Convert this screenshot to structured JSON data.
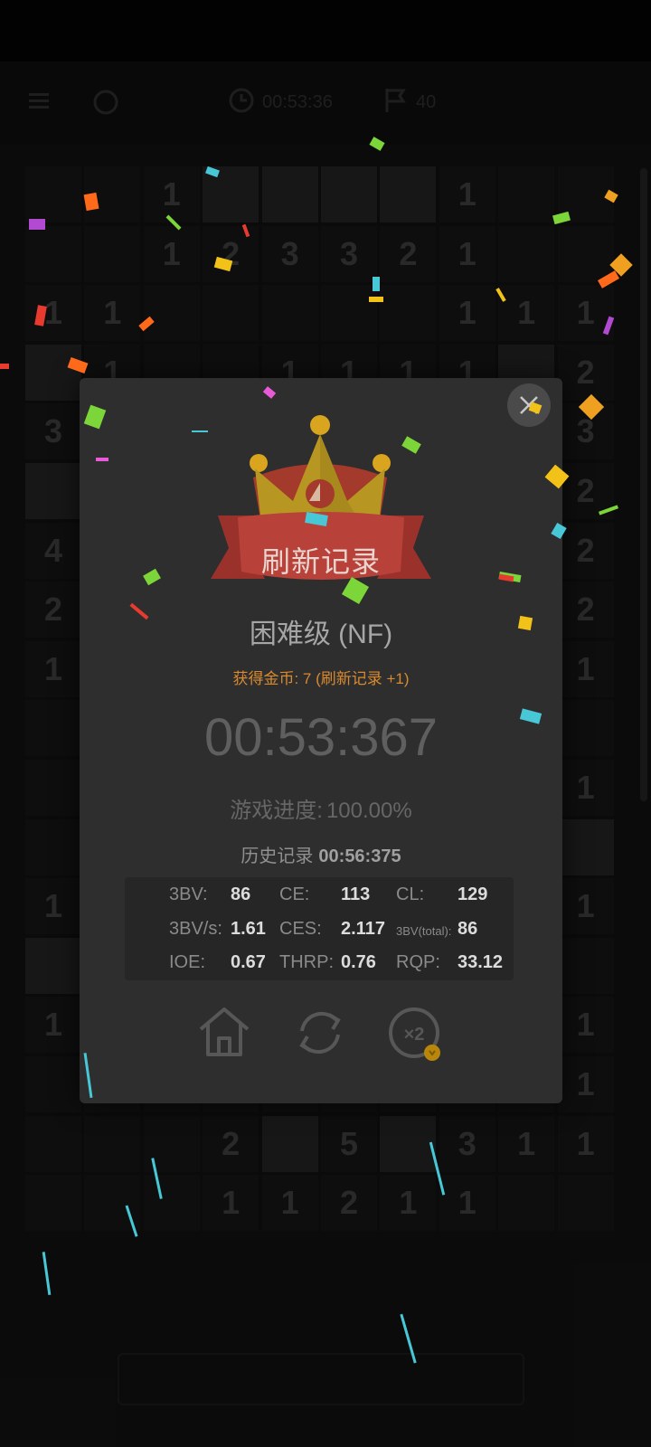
{
  "topbar": {
    "timer": "00:53:36",
    "mines": "40"
  },
  "board": {
    "rows": [
      [
        " ",
        " ",
        "1",
        "#",
        "#",
        "#",
        "#",
        "1",
        " ",
        " "
      ],
      [
        " ",
        " ",
        "1",
        "2",
        "3",
        "3",
        "2",
        "1",
        " ",
        " "
      ],
      [
        "1",
        "1",
        " ",
        " ",
        " ",
        " ",
        " ",
        "1",
        "1",
        "1"
      ],
      [
        "#",
        "1",
        " ",
        " ",
        "1",
        "1",
        "1",
        "1",
        "#",
        "2"
      ],
      [
        "3",
        " ",
        " ",
        " ",
        " ",
        " ",
        " ",
        " ",
        " ",
        "3"
      ],
      [
        "#",
        " ",
        " ",
        " ",
        " ",
        " ",
        " ",
        " ",
        " ",
        "2"
      ],
      [
        "4",
        " ",
        " ",
        " ",
        " ",
        " ",
        " ",
        " ",
        " ",
        "2"
      ],
      [
        "2",
        " ",
        " ",
        " ",
        " ",
        " ",
        " ",
        " ",
        " ",
        "2"
      ],
      [
        "1",
        " ",
        " ",
        " ",
        " ",
        " ",
        " ",
        " ",
        " ",
        "1"
      ],
      [
        " ",
        " ",
        " ",
        " ",
        " ",
        " ",
        " ",
        " ",
        " ",
        " "
      ],
      [
        " ",
        " ",
        " ",
        " ",
        " ",
        " ",
        " ",
        " ",
        " ",
        "1"
      ],
      [
        " ",
        " ",
        " ",
        " ",
        " ",
        " ",
        " ",
        " ",
        " ",
        "#"
      ],
      [
        "1",
        " ",
        " ",
        " ",
        " ",
        " ",
        " ",
        " ",
        " ",
        "1"
      ],
      [
        "#",
        " ",
        " ",
        " ",
        " ",
        " ",
        " ",
        " ",
        " ",
        " "
      ],
      [
        "1",
        " ",
        " ",
        " ",
        " ",
        " ",
        " ",
        " ",
        " ",
        "1"
      ],
      [
        " ",
        " ",
        " ",
        " ",
        " ",
        " ",
        " ",
        " ",
        " ",
        "1"
      ],
      [
        " ",
        " ",
        " ",
        "2",
        "#",
        "5",
        "#",
        "3",
        "1",
        "1"
      ],
      [
        " ",
        " ",
        " ",
        "1",
        "1",
        "2",
        "1",
        "1",
        " ",
        " "
      ]
    ]
  },
  "dialog": {
    "banner": "刷新记录",
    "difficulty": "困难级 (NF)",
    "coins": "获得金币: 7 (刷新记录 +1)",
    "time": "00:53:367",
    "progress_label": "游戏进度:",
    "progress_value": "100.00%",
    "history_label": "历史记录",
    "history_value": "00:56:375",
    "stats": {
      "bv_label": "3BV:",
      "bv": "86",
      "ce_label": "CE:",
      "ce": "113",
      "cl_label": "CL:",
      "cl": "129",
      "bvs_label": "3BV/s:",
      "bvs": "1.61",
      "ces_label": "CES:",
      "ces": "2.117",
      "bvtotal_label": "3BV(total):",
      "bvtotal": "86",
      "ioe_label": "IOE:",
      "ioe": "0.67",
      "thrp_label": "THRP:",
      "thrp": "0.76",
      "rqp_label": "RQP:",
      "rqp": "33.12"
    },
    "buttons": {
      "double_label": "×2"
    }
  },
  "icons": [
    "menu-icon",
    "target-icon",
    "clock-icon",
    "flag-icon",
    "close-icon",
    "home-icon",
    "restart-icon",
    "double-coins-icon"
  ],
  "colors": {
    "accent_orange": "#d98a2e",
    "crown_gold": "#c9a227",
    "ribbon_red": "#b8423a",
    "dialog_bg": "#2e2e2e"
  }
}
